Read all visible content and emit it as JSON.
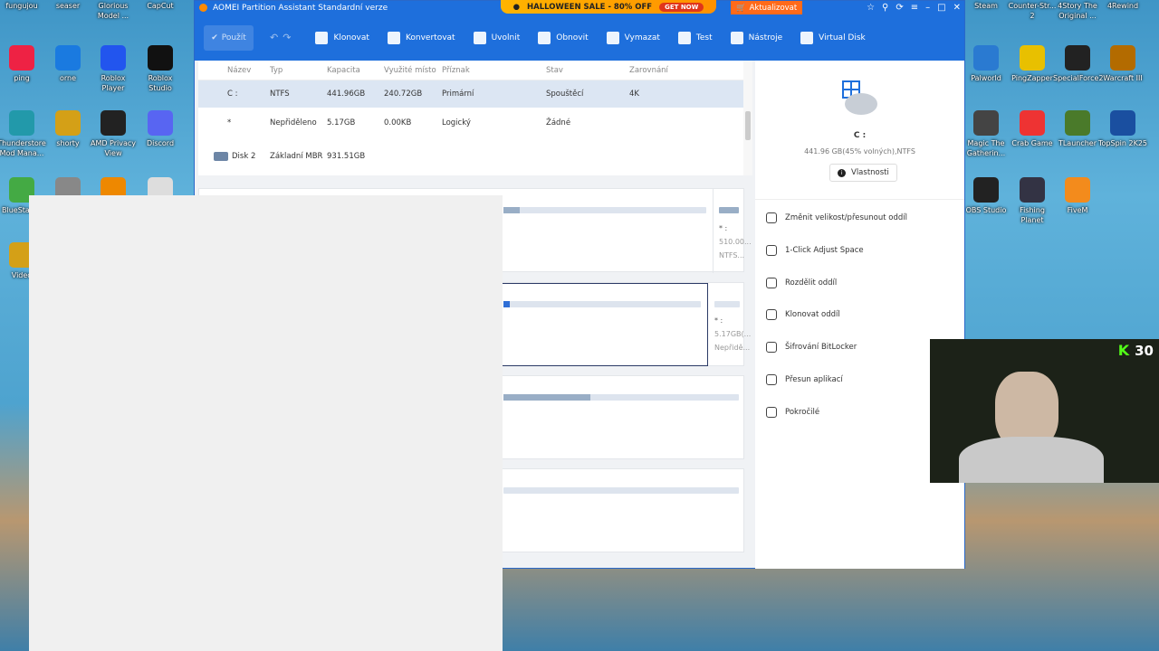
{
  "desktop_left": [
    {
      "label": "fungujou",
      "color": "#c99a00"
    },
    {
      "label": "seaser",
      "color": "#c99a00"
    },
    {
      "label": "Glorious Model ...",
      "color": "#333"
    },
    {
      "label": "CapCut",
      "color": "#111"
    },
    {
      "label": "ping",
      "color": "#e24"
    },
    {
      "label": "orne",
      "color": "#1a7ae0"
    },
    {
      "label": "Roblox Player",
      "color": "#2255ee"
    },
    {
      "label": "Roblox Studio",
      "color": "#111"
    },
    {
      "label": "Thunderstore Mod Mana...",
      "color": "#29a"
    },
    {
      "label": "shorty",
      "color": "#d4a017"
    },
    {
      "label": "AMD Privacy View",
      "color": "#222"
    },
    {
      "label": "Discord",
      "color": "#5865f2"
    },
    {
      "label": "BlueStacks",
      "color": "#4a4"
    },
    {
      "label": "",
      "color": "#888"
    },
    {
      "label": "",
      "color": "#e80"
    },
    {
      "label": "",
      "color": "#ddd"
    },
    {
      "label": "Video",
      "color": "#d4a017"
    }
  ],
  "desktop_right": [
    {
      "label": "Steam",
      "color": "#1b2838"
    },
    {
      "label": "Counter-Str... 2",
      "color": "#333"
    },
    {
      "label": "4Story The Original ...",
      "color": "#333"
    },
    {
      "label": "4Rewind",
      "color": "#a22"
    },
    {
      "label": "Palworld",
      "color": "#2a7ad1"
    },
    {
      "label": "PingZapper",
      "color": "#e8c000"
    },
    {
      "label": "SpecialForce2",
      "color": "#222"
    },
    {
      "label": "Warcraft III",
      "color": "#b36b00"
    },
    {
      "label": "Magic The Gatherin...",
      "color": "#444"
    },
    {
      "label": "Crab Game",
      "color": "#e33"
    },
    {
      "label": "TLauncher",
      "color": "#4a7a2a"
    },
    {
      "label": "TopSpin 2K25",
      "color": "#1a4fa0"
    },
    {
      "label": "OBS Studio",
      "color": "#222"
    },
    {
      "label": "Fishing Planet",
      "color": "#334"
    },
    {
      "label": "FiveM",
      "color": "#f38b1c"
    }
  ],
  "window": {
    "title": "AOMEI Partition Assistant Standardní verze",
    "promo_text": "HALLOWEEN SALE - 80% OFF",
    "promo_button": "GET NOW",
    "upgrade": "Aktualizovat"
  },
  "toolbar": {
    "apply": "Použít",
    "items": [
      "Klonovat",
      "Konvertovat",
      "Uvolnit",
      "Obnovit",
      "Vymazat",
      "Test",
      "Nástroje",
      "Virtual Disk"
    ]
  },
  "table": {
    "headers": [
      "Název",
      "Typ",
      "Kapacita",
      "Využité místo",
      "Příznak",
      "Stav",
      "Zarovnání"
    ],
    "rows": [
      [
        "C :",
        "NTFS",
        "441.96GB",
        "240.72GB",
        "Primární",
        "Spouštěcí",
        "4K"
      ],
      [
        "*",
        "Nepřiděleno",
        "5.17GB",
        "0.00KB",
        "Logický",
        "Žádné",
        ""
      ]
    ],
    "disk2": {
      "name": "Disk 2",
      "type": "Základní MBR",
      "size": "931.51GB"
    }
  },
  "cards": {
    "card1_label": "* :",
    "card1_size": "510.00...",
    "card1_fs": "NTFS...",
    "card2_label": "* :",
    "card2_size": "5.17GB(...",
    "card2_fs": "Nepřidě...",
    "card3_fill": 0.37
  },
  "details": {
    "drive": "C :",
    "info": "441.96 GB(45% volných),NTFS",
    "properties": "Vlastnosti",
    "actions": [
      "Změnit velikost/přesunout oddíl",
      "1-Click Adjust Space",
      "Rozdělit oddíl",
      "Klonovat oddíl",
      "Šifrování BitLocker",
      "Přesun aplikací",
      "Pokročilé"
    ]
  },
  "webcam": {
    "overlay_count": "30"
  }
}
